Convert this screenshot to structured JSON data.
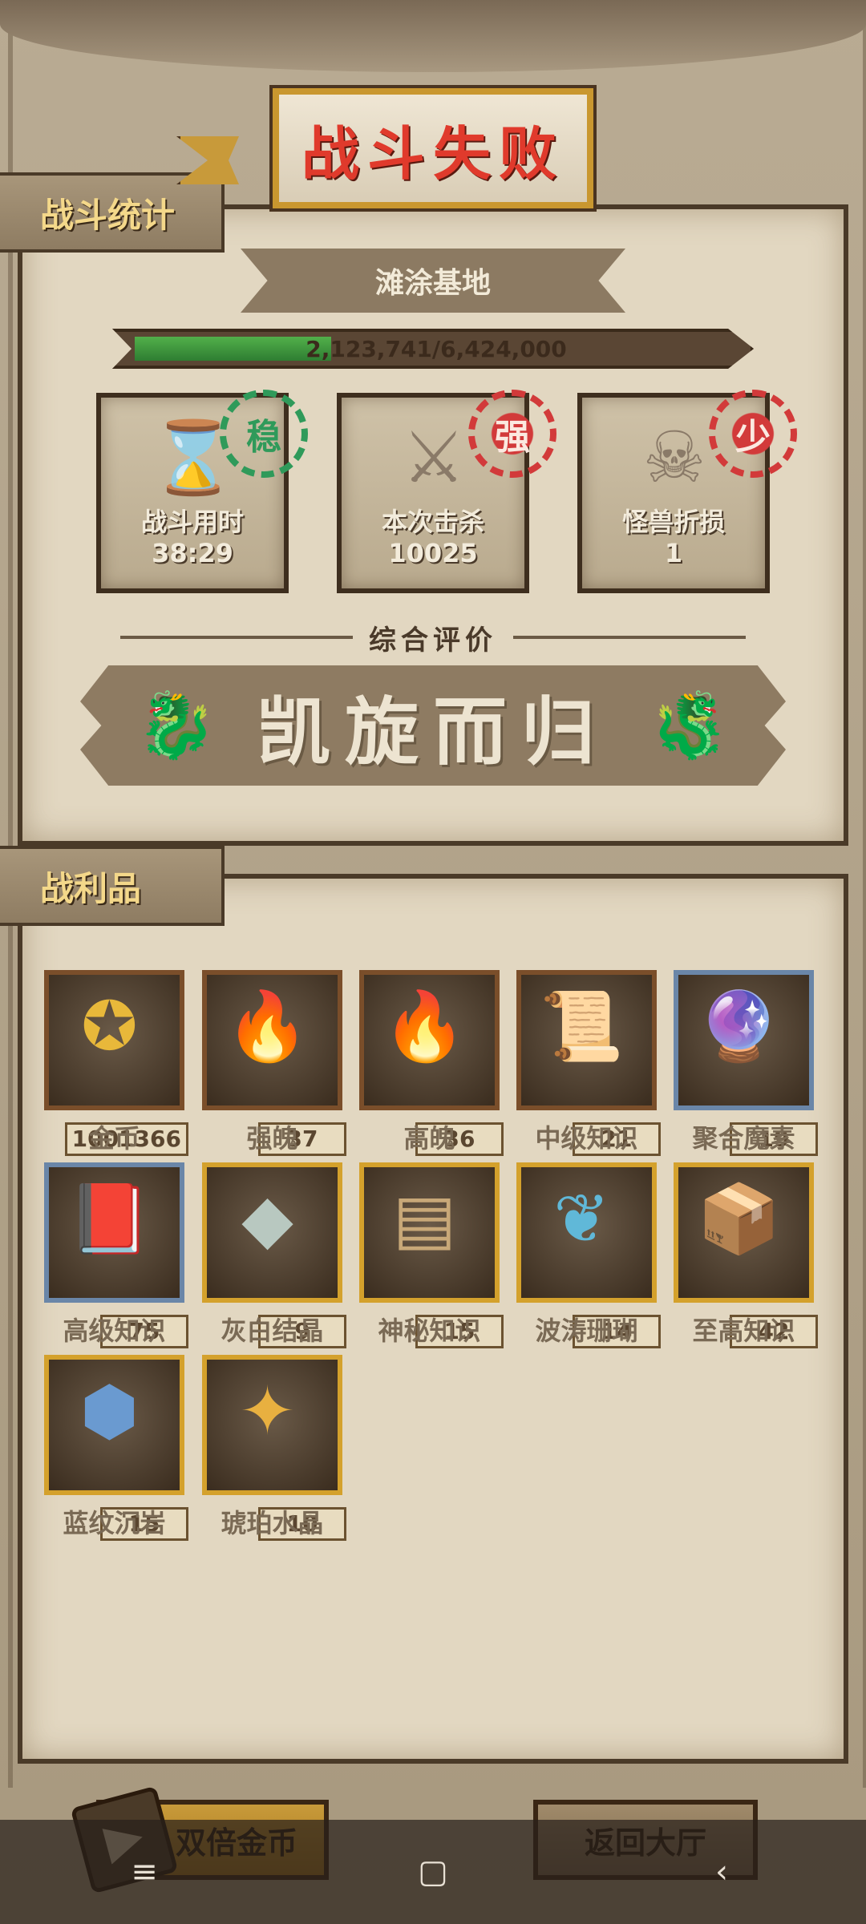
{
  "title": "战斗失败",
  "stats_section": {
    "tab_label": "战斗统计",
    "location": "滩涂基地",
    "progress": {
      "text": "2,123,741/6,424,000",
      "fraction": 0.3306
    },
    "cards": [
      {
        "label": "战斗用时",
        "value": "38:29",
        "stamp": "稳",
        "stamp_color": "#2f9a5a"
      },
      {
        "label": "本次击杀",
        "value": "10025",
        "stamp": "强",
        "stamp_color": "#d23a3a"
      },
      {
        "label": "怪兽折损",
        "value": "1",
        "stamp": "少",
        "stamp_color": "#d23a3a"
      }
    ],
    "rating_title": "综合评价",
    "rating_text": "凯旋而归"
  },
  "loot_section": {
    "tab_label": "战利品",
    "items": [
      {
        "name": "金币",
        "count": "1001366",
        "icon": "gold-coin-icon"
      },
      {
        "name": "强魄",
        "count": "37",
        "icon": "fire-spirit-icon"
      },
      {
        "name": "高魄",
        "count": "36",
        "icon": "high-spirit-icon"
      },
      {
        "name": "中级知识",
        "count": "21",
        "icon": "scroll-icon"
      },
      {
        "name": "聚合魔素",
        "count": "19",
        "icon": "magic-orb-icon"
      },
      {
        "name": "高级知识",
        "count": "75",
        "icon": "book-icon"
      },
      {
        "name": "灰白结晶",
        "count": "9",
        "icon": "gray-crystal-icon"
      },
      {
        "name": "神秘知识",
        "count": "15",
        "icon": "tablet-icon"
      },
      {
        "name": "波涛珊瑚",
        "count": "14",
        "icon": "coral-icon"
      },
      {
        "name": "至高知识",
        "count": "42",
        "icon": "supreme-book-icon"
      },
      {
        "name": "蓝纹沉岩",
        "count": "15",
        "icon": "blue-rock-icon"
      },
      {
        "name": "琥珀水晶",
        "count": "10",
        "icon": "amber-crystal-icon"
      }
    ]
  },
  "buttons": {
    "double_gold": "双倍金币",
    "return_hall": "返回大厅"
  },
  "navbar": {
    "menu": "≡",
    "home": "▢",
    "back": "‹"
  }
}
